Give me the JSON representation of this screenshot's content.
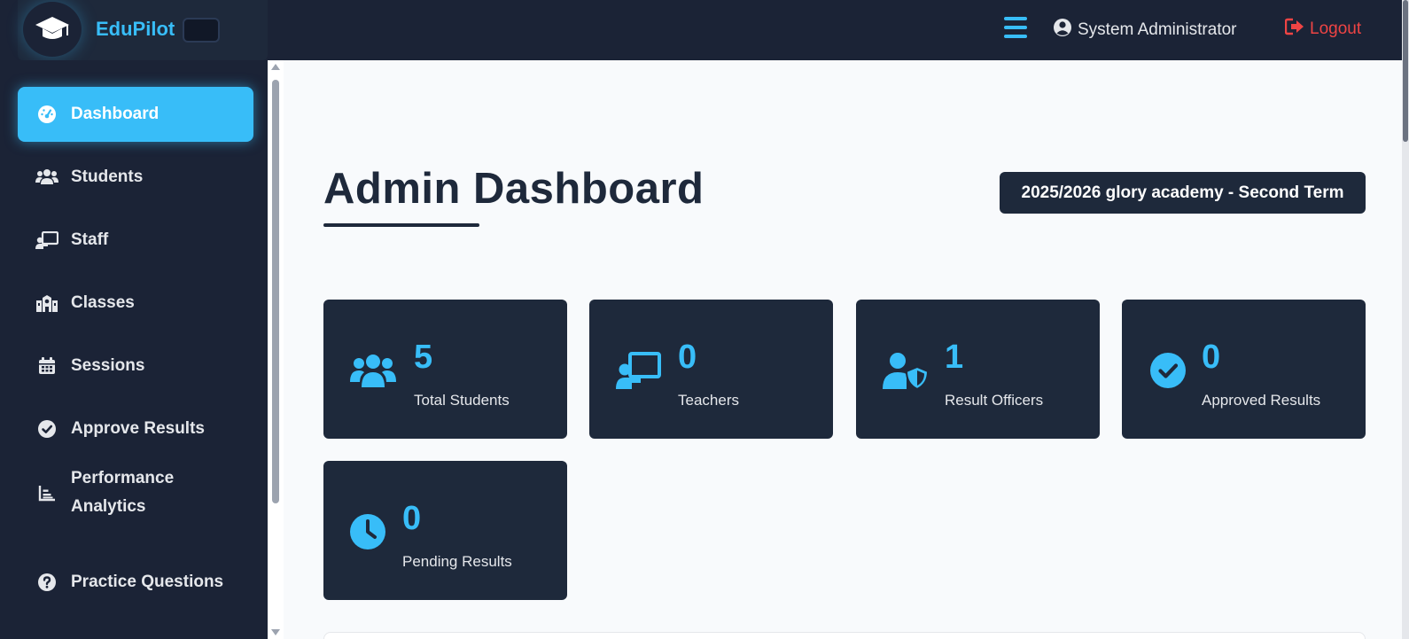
{
  "app": {
    "brand_name": "EduPilot",
    "user_name": "System Administrator",
    "logout_label": "Logout",
    "accent_color": "#38bdf8",
    "dark_color": "#1e293b",
    "danger_color": "#ef4444"
  },
  "sidebar": {
    "items": [
      {
        "label": "Dashboard",
        "icon": "gauge-icon",
        "active": true
      },
      {
        "label": "Students",
        "icon": "users-icon"
      },
      {
        "label": "Staff",
        "icon": "chalkboard-teacher-icon"
      },
      {
        "label": "Classes",
        "icon": "school-icon"
      },
      {
        "label": "Sessions",
        "icon": "calendar-icon"
      },
      {
        "label": "Approve Results",
        "icon": "check-circle-icon"
      },
      {
        "label": "Performance Analytics",
        "icon": "chart-icon"
      },
      {
        "label": "Practice Questions",
        "icon": "question-circle-icon"
      }
    ]
  },
  "main": {
    "title": "Admin Dashboard",
    "session_label": "2025/2026 glory academy - Second Term",
    "stats": [
      {
        "value": "5",
        "label": "Total Students",
        "icon": "users-icon"
      },
      {
        "value": "0",
        "label": "Teachers",
        "icon": "chalkboard-teacher-icon"
      },
      {
        "value": "1",
        "label": "Result Officers",
        "icon": "user-shield-icon"
      },
      {
        "value": "0",
        "label": "Approved Results",
        "icon": "check-circle-icon"
      },
      {
        "value": "0",
        "label": "Pending Results",
        "icon": "clock-icon"
      }
    ]
  }
}
